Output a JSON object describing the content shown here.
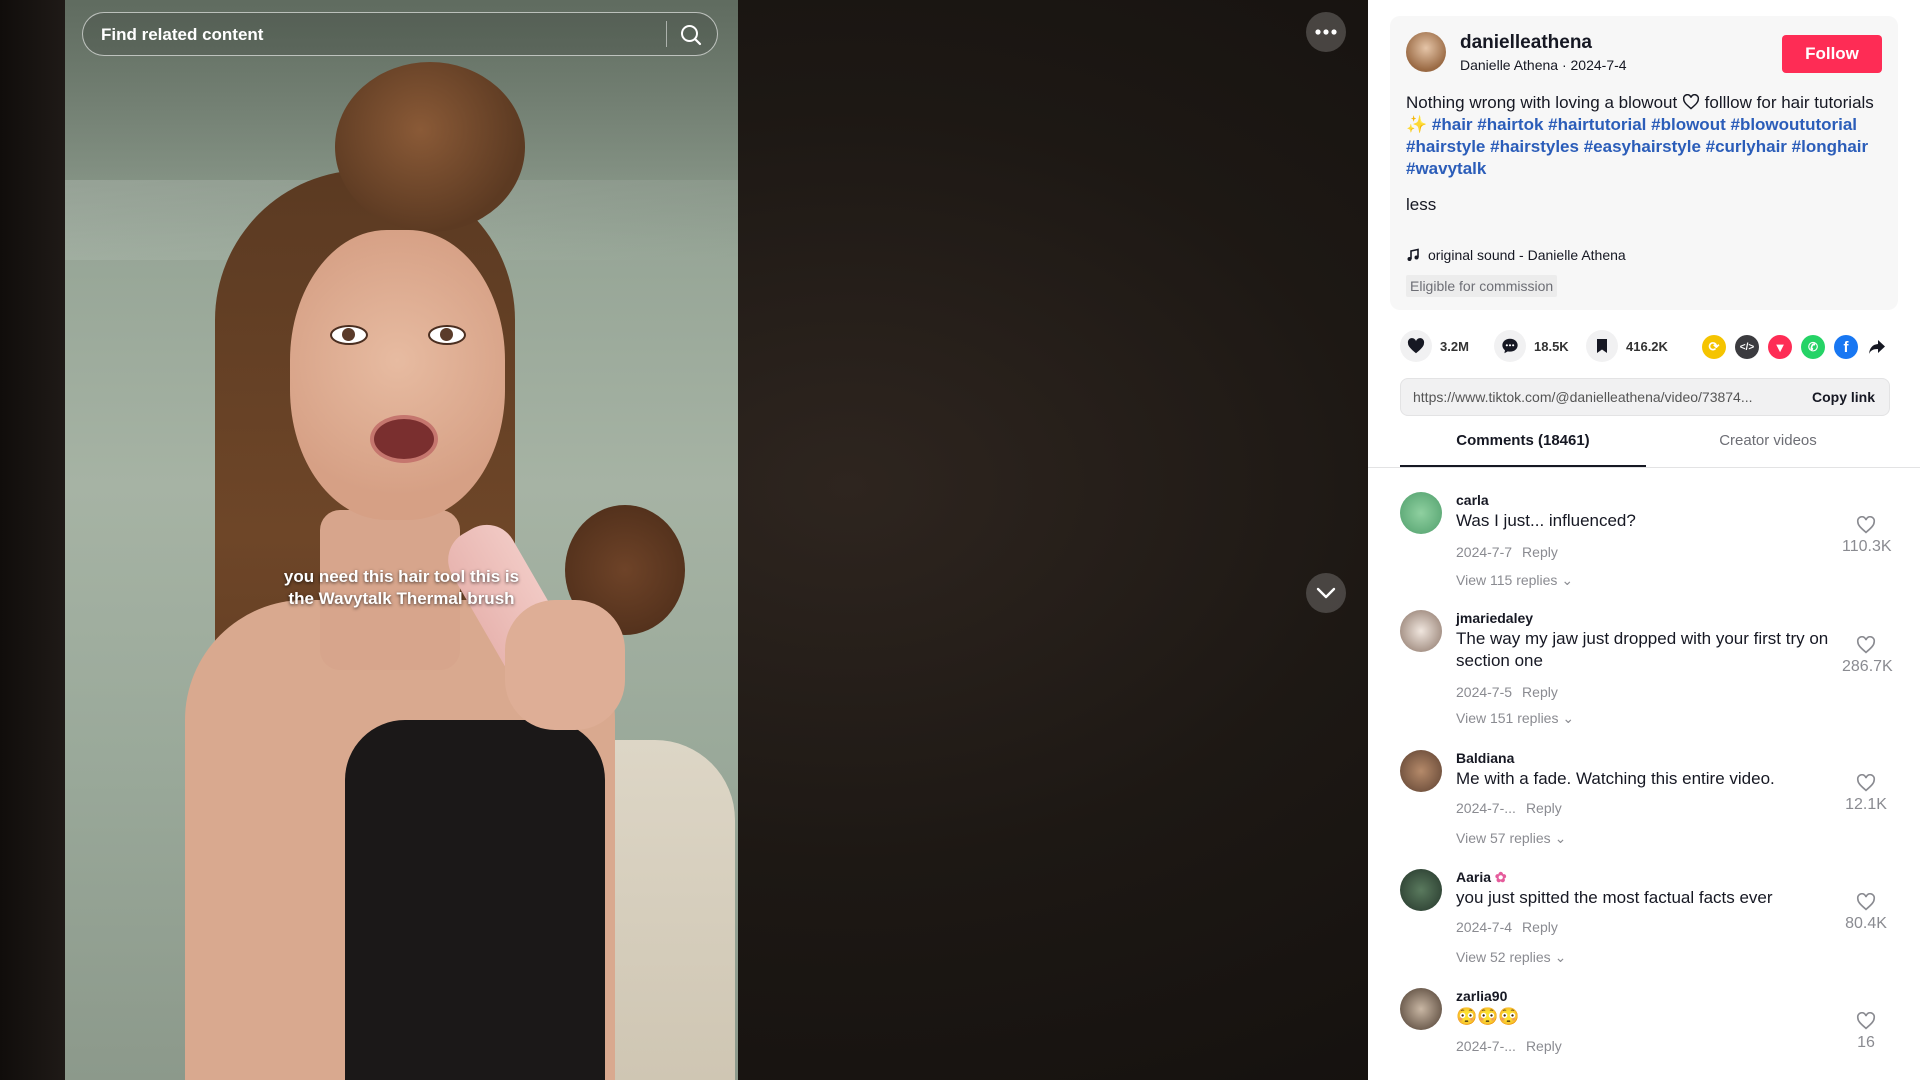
{
  "search": {
    "placeholder": "Find related content"
  },
  "video": {
    "caption_line1": "you need this hair tool this is",
    "caption_line2": "the Wavytalk Thermal brush"
  },
  "post": {
    "username": "danielleathena",
    "display_name": "Danielle Athena",
    "date": "2024-7-4",
    "subline": "Danielle Athena · 2024-7-4",
    "follow_label": "Follow",
    "desc_prefix": "Nothing wrong with loving a blowout",
    "desc_mid": " folllow for hair tutorials",
    "hashtags": [
      "#hair",
      "#hairtok",
      "#hairtutorial",
      "#blowout",
      "#blowoututorial",
      "#hairstyle",
      "#hairstyles",
      "#easyhairstyle",
      "#curlyhair",
      "#longhair",
      "#wavytalk"
    ],
    "less_label": "less",
    "sound": "original sound - Danielle Athena",
    "commission": "Eligible for commission"
  },
  "actions": {
    "likes": "3.2M",
    "comments": "18.5K",
    "saves": "416.2K"
  },
  "share_icons": [
    "repost-icon",
    "embed-icon",
    "send-icon",
    "whatsapp-icon",
    "facebook-icon",
    "share-arrow-icon"
  ],
  "link": {
    "url": "https://www.tiktok.com/@danielleathena/video/73874...",
    "copy_label": "Copy link"
  },
  "tabs": {
    "comments": "Comments (18461)",
    "creator": "Creator videos"
  },
  "colors": {
    "follow": "#fe2c55",
    "hashtag": "#2b5db9"
  },
  "comments": [
    {
      "user": "carla",
      "text": "Was I just... influenced?",
      "date": "2024-7-7",
      "reply": "Reply",
      "replies": "View 115 replies",
      "likes": "110.3K"
    },
    {
      "user": "jmariedaley",
      "text": "The way my jaw just dropped with your first try on section one",
      "date": "2024-7-5",
      "reply": "Reply",
      "replies": "View 151 replies",
      "likes": "286.7K"
    },
    {
      "user": "Baldiana",
      "text": "Me with a fade. Watching this entire video.",
      "date": "2024-7-...",
      "reply": "Reply",
      "replies": "View 57 replies",
      "likes": "12.1K"
    },
    {
      "user": "Aaria",
      "text": "you just spitted the most factual facts ever",
      "date": "2024-7-4",
      "reply": "Reply",
      "replies": "View 52 replies",
      "likes": "80.4K"
    },
    {
      "user": "zarlia90",
      "text": "😳😳😳",
      "date": "2024-7-...",
      "reply": "Reply",
      "replies": "",
      "likes": "16"
    }
  ]
}
